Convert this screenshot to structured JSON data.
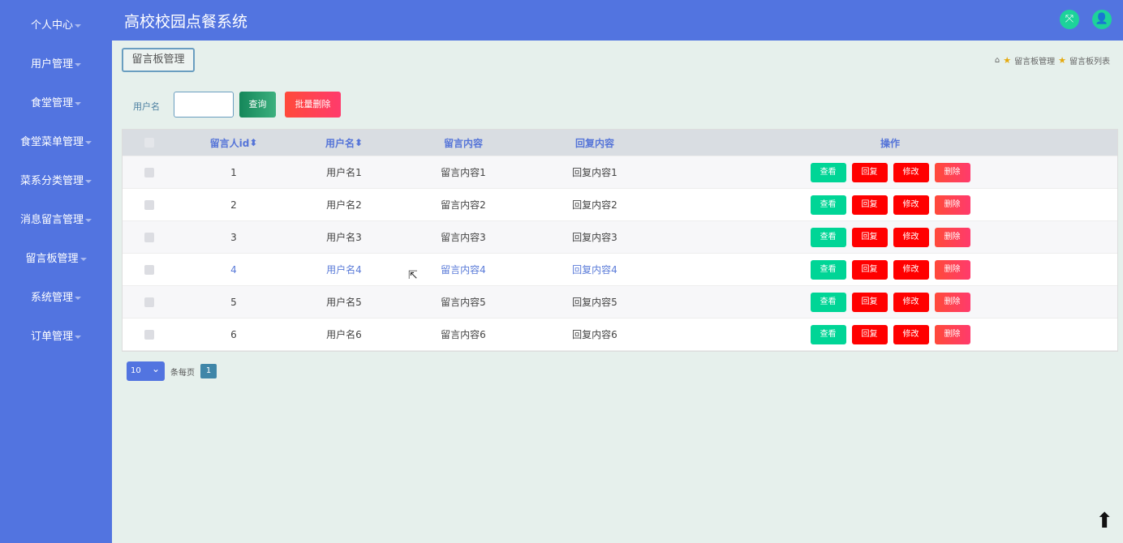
{
  "app": {
    "title": "高校校园点餐系统"
  },
  "sidebar": {
    "items": [
      {
        "label": "个人中心"
      },
      {
        "label": "用户管理"
      },
      {
        "label": "食堂管理"
      },
      {
        "label": "食堂菜单管理"
      },
      {
        "label": "菜系分类管理"
      },
      {
        "label": "消息留言管理"
      },
      {
        "label": "留言板管理"
      },
      {
        "label": "系统管理"
      },
      {
        "label": "订单管理"
      }
    ]
  },
  "page": {
    "tab": "留言板管理",
    "breadcrumb": [
      "留言板管理",
      "留言板列表"
    ]
  },
  "search": {
    "label": "用户名",
    "value": "",
    "query": "查询",
    "bulk_delete": "批量删除"
  },
  "table": {
    "headers": [
      "留言人id",
      "用户名",
      "留言内容",
      "回复内容",
      "操作"
    ],
    "rows": [
      {
        "id": "1",
        "user": "用户名1",
        "content": "留言内容1",
        "reply": "回复内容1"
      },
      {
        "id": "2",
        "user": "用户名2",
        "content": "留言内容2",
        "reply": "回复内容2"
      },
      {
        "id": "3",
        "user": "用户名3",
        "content": "留言内容3",
        "reply": "回复内容3"
      },
      {
        "id": "4",
        "user": "用户名4",
        "content": "留言内容4",
        "reply": "回复内容4"
      },
      {
        "id": "5",
        "user": "用户名5",
        "content": "留言内容5",
        "reply": "回复内容5"
      },
      {
        "id": "6",
        "user": "用户名6",
        "content": "留言内容6",
        "reply": "回复内容6"
      }
    ],
    "ops": {
      "view": "查看",
      "reply": "回复",
      "edit": "修改",
      "delete": "删除"
    }
  },
  "pager": {
    "page_size": "10",
    "per_page": "条每页",
    "current": "1"
  }
}
